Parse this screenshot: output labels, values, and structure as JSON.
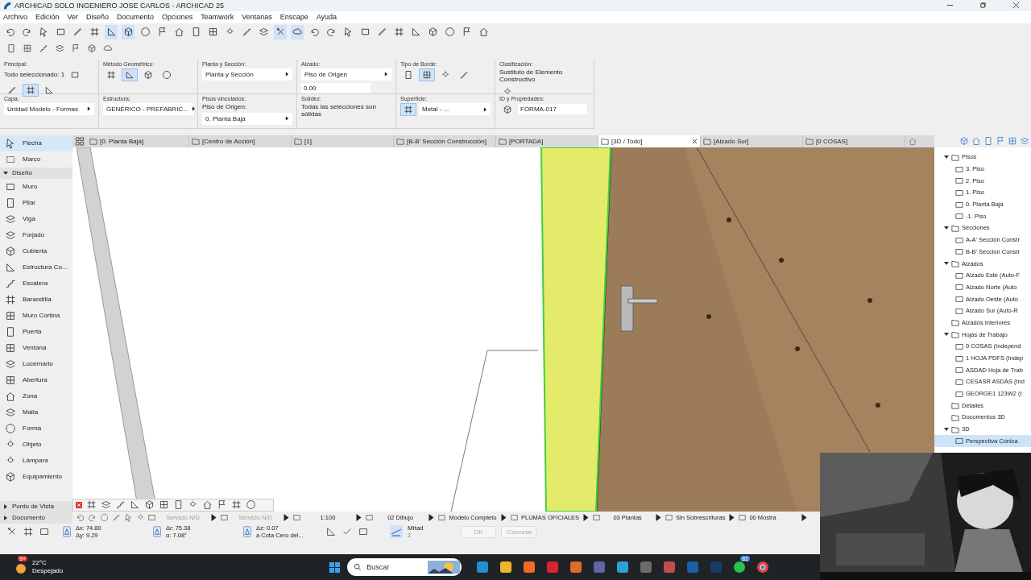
{
  "window": {
    "title": "ARCHICAD SOLO INGENIERO JOSE CARLOS - ARCHICAD 25"
  },
  "menu": [
    "Archivo",
    "Edición",
    "Ver",
    "Diseño",
    "Documento",
    "Opciones",
    "Teamwork",
    "Ventanas",
    "Enscape",
    "Ayuda"
  ],
  "toolbar": [
    {
      "selected": false
    },
    {
      "selected": false
    },
    {
      "selected": false
    },
    {
      "selected": false
    },
    {
      "selected": false
    },
    {
      "selected": false
    },
    {
      "selected": true
    },
    {
      "selected": true
    },
    {
      "selected": false
    },
    {
      "selected": false
    },
    {
      "selected": false
    },
    {
      "selected": false
    },
    {
      "selected": false
    },
    {
      "selected": false
    },
    {
      "selected": false
    },
    {
      "selected": false
    },
    {
      "selected": true
    },
    {
      "selected": true
    },
    {
      "selected": false
    },
    {
      "selected": false
    },
    {
      "selected": false
    },
    {
      "selected": false
    },
    {
      "selected": false
    },
    {
      "selected": false
    },
    {
      "selected": false
    },
    {
      "selected": false
    },
    {
      "selected": false
    },
    {
      "selected": false
    },
    {
      "selected": false
    }
  ],
  "info_box": {
    "panels": [
      {
        "label": "Principal:",
        "text": "Todo seleccionado: 1",
        "buttons": [
          {
            "selected": false
          },
          {
            "selected": false
          },
          {
            "selected": true
          },
          {
            "selected": false
          }
        ]
      },
      {
        "label": "Método Geométrico:",
        "buttons": [
          {
            "selected": false
          },
          {
            "selected": true
          },
          {
            "selected": false
          },
          {
            "selected": false
          }
        ]
      },
      {
        "label": "Planta y Sección:",
        "value": "Planta y Sección"
      },
      {
        "label": "Alzado:",
        "value": "Piso de Origen",
        "field": "0.00"
      },
      {
        "label": "Tipo de Borde:",
        "buttons": [
          {
            "selected": false
          },
          {
            "selected": true
          },
          {
            "selected": false
          },
          {
            "selected": false
          }
        ]
      },
      {
        "label": "Clasificación:",
        "text": "Sustituto de Elemento Constructivo",
        "buttons": [
          {
            "selected": false
          }
        ]
      },
      {
        "label": "Capa:",
        "value": "Unidad Modelo - Formas"
      },
      {
        "label": "Estructura:",
        "value": "GENÉRICO - PREFABRIC..."
      },
      {
        "label": "Pisos vinculados:",
        "text": "Piso de Origen:",
        "value": "0. Planta Baja"
      },
      {
        "label": "Solidez:",
        "text": "Todas las selecciones son sólidas"
      },
      {
        "label": "Superficie:",
        "buttons": [
          {
            "selected": true
          }
        ],
        "value": "Metal - ..."
      },
      {
        "label": "ID y Propiedades:",
        "field": "FORMA-017",
        "buttons": [
          {
            "selected": false
          }
        ]
      }
    ]
  },
  "tabs": [
    {
      "label": "[0. Planta Baja]",
      "selected": false
    },
    {
      "label": "[Centro de Acción]",
      "selected": false
    },
    {
      "label": "[1]",
      "selected": false
    },
    {
      "label": "[B-B' Sección Construcción]",
      "selected": false
    },
    {
      "label": "[PORTADA]",
      "selected": false
    },
    {
      "label": "[3D / Todo]",
      "selected": true
    },
    {
      "label": "[Alzado Sur]",
      "selected": false
    },
    {
      "label": "[0 COSAS]",
      "selected": false
    }
  ],
  "toolbox": {
    "top": [
      {
        "label": "Flecha",
        "selected": true
      },
      {
        "label": "Marco",
        "selected": false
      }
    ],
    "section": {
      "label": "Diseño",
      "expanded": true
    },
    "items": [
      {
        "label": "Muro",
        "selected": false
      },
      {
        "label": "Pilar",
        "selected": false
      },
      {
        "label": "Viga",
        "selected": false
      },
      {
        "label": "Forjado",
        "selected": false
      },
      {
        "label": "Cubierta",
        "selected": false
      },
      {
        "label": "Estructura Co...",
        "selected": false
      },
      {
        "label": "Escalera",
        "selected": false
      },
      {
        "label": "Barandilla",
        "selected": false
      },
      {
        "label": "Muro Cortina",
        "selected": false
      },
      {
        "label": "Puerta",
        "selected": false
      },
      {
        "label": "Ventana",
        "selected": false
      },
      {
        "label": "Lucernario",
        "selected": false
      },
      {
        "label": "Abertura",
        "selected": false
      },
      {
        "label": "Zona",
        "selected": false
      },
      {
        "label": "Malla",
        "selected": false
      },
      {
        "label": "Forma",
        "selected": false
      },
      {
        "label": "Objeto",
        "selected": false
      },
      {
        "label": "Lámpara",
        "selected": false
      },
      {
        "label": "Equipamiento",
        "selected": false
      }
    ],
    "bottom": [
      {
        "label": "Punto de Vista",
        "expanded": false
      },
      {
        "label": "Documento",
        "expanded": false
      }
    ]
  },
  "navigator": {
    "tree": [
      {
        "label": "Pisos",
        "expanded": true,
        "selected": false,
        "children": [
          {
            "label": "3. Piso",
            "selected": false
          },
          {
            "label": "2. Piso",
            "selected": false
          },
          {
            "label": "1. Piso",
            "selected": false
          },
          {
            "label": "0. Planta Baja",
            "selected": false
          },
          {
            "label": "-1. Piso",
            "selected": false
          }
        ]
      },
      {
        "label": "Secciones",
        "expanded": true,
        "selected": false,
        "children": [
          {
            "label": "A-A' Sección Constr",
            "selected": false
          },
          {
            "label": "B-B' Sección Constr",
            "selected": false
          }
        ]
      },
      {
        "label": "Alzados",
        "expanded": true,
        "selected": false,
        "children": [
          {
            "label": "Alzado Este (Auto-F",
            "selected": false
          },
          {
            "label": "Alzado Norte (Auto",
            "selected": false
          },
          {
            "label": "Alzado Oeste (Auto",
            "selected": false
          },
          {
            "label": "Alzado Sur (Auto-R",
            "selected": false
          }
        ]
      },
      {
        "label": "Alzados Interiores",
        "selected": false
      },
      {
        "label": "Hojas de Trabajo",
        "expanded": true,
        "selected": false,
        "children": [
          {
            "label": "0 COSAS (Independ",
            "selected": false
          },
          {
            "label": "1 HOJA PDFS (Indep",
            "selected": false
          },
          {
            "label": "ASDAD Hoja de Trab",
            "selected": false
          },
          {
            "label": "CESASR ASDAS (Ind",
            "selected": false
          },
          {
            "label": "GEORGE1 123W2 (I",
            "selected": false
          }
        ]
      },
      {
        "label": "Detalles",
        "selected": false
      },
      {
        "label": "Documentos 3D",
        "selected": false
      },
      {
        "label": "3D",
        "expanded": true,
        "selected": false,
        "children": [
          {
            "label": "Perspectiva Cónica",
            "selected": true
          }
        ]
      }
    ]
  },
  "status_bar": {
    "row_1": [
      {
        "text": "Servicio N/D",
        "disabled": true
      },
      {
        "text": "Servicio N/D",
        "disabled": true
      },
      {
        "text": "1:100",
        "disabled": false
      },
      {
        "text": "02 Dibujo",
        "disabled": false
      },
      {
        "text": "Modelo Completo",
        "disabled": false
      },
      {
        "text": "PLUMAS OFICIALES",
        "disabled": false
      },
      {
        "text": "03 Plantas",
        "disabled": false
      },
      {
        "text": "Sin Sobrescrituras",
        "disabled": false
      },
      {
        "text": "00 Mostra",
        "disabled": false
      }
    ],
    "coordinates": [
      [
        "Δx: 74.80",
        "Δy: 9.29"
      ],
      [
        "Δr: 75.38",
        "α: 7.08°"
      ],
      [
        "Δz: 0.07",
        "a Cota Cero del..."
      ]
    ],
    "snap": {
      "label": "Mitad",
      "value": "2"
    },
    "buttons": [
      {
        "label": "OK",
        "disabled": true
      },
      {
        "label": "Cancelar",
        "disabled": true
      }
    ]
  },
  "taskbar": {
    "weather_badge": "9+",
    "temperature": "22°C",
    "weather": "Despejado",
    "search": {
      "placeholder": "Buscar"
    },
    "chat_badge": "82"
  }
}
